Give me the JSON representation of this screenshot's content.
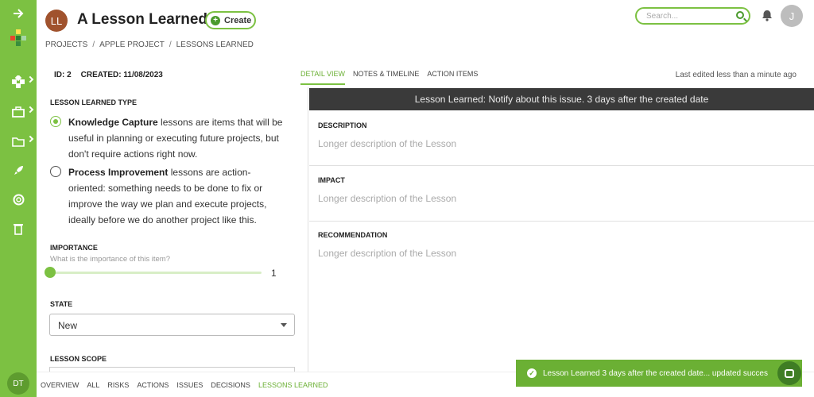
{
  "header": {
    "avatar_initials": "LL",
    "title": "A Lesson Learned",
    "create_label": "Create"
  },
  "breadcrumb": [
    "PROJECTS",
    "APPLE PROJECT",
    "LESSONS LEARNED"
  ],
  "search": {
    "placeholder": "Search..."
  },
  "user": {
    "initial": "J"
  },
  "meta": {
    "id": "ID: 2",
    "created": "CREATED: 11/08/2023"
  },
  "tabs": [
    {
      "label": "DETAIL VIEW",
      "active": true
    },
    {
      "label": "NOTES & TIMELINE",
      "active": false
    },
    {
      "label": "ACTION ITEMS",
      "active": false
    }
  ],
  "last_edited": "Last edited less than a minute ago",
  "lesson_type": {
    "label": "LESSON LEARNED TYPE",
    "options": [
      {
        "title": "Knowledge Capture",
        "text": " lessons are items that will be useful in planning or executing future projects, but don't require actions right now.",
        "checked": true
      },
      {
        "title": "Process Improvement",
        "text": " lessons are action-oriented: something needs to be done to fix or improve the way we plan and execute projects, ideally before we do another project like this.",
        "checked": false
      }
    ]
  },
  "importance": {
    "label": "IMPORTANCE",
    "subtitle": "What is the importance of this item?",
    "value": "1"
  },
  "state": {
    "label": "STATE",
    "value": "New"
  },
  "scope": {
    "label": "LESSON SCOPE"
  },
  "banner": "Lesson Learned: Notify about this issue. 3 days after the created date",
  "details": [
    {
      "label": "DESCRIPTION",
      "value": "Longer description of the Lesson"
    },
    {
      "label": "IMPACT",
      "value": "Longer description of the Lesson"
    },
    {
      "label": "RECOMMENDATION",
      "value": "Longer description of the Lesson"
    }
  ],
  "bottom_nav": [
    {
      "label": "OVERVIEW",
      "active": false
    },
    {
      "label": "ALL",
      "active": false
    },
    {
      "label": "RISKS",
      "active": false
    },
    {
      "label": "ACTIONS",
      "active": false
    },
    {
      "label": "ISSUES",
      "active": false
    },
    {
      "label": "DECISIONS",
      "active": false
    },
    {
      "label": "LESSONS LEARNED",
      "active": true
    }
  ],
  "workspace_initials": "DT",
  "toast": "Lesson Learned 3 days after the created date... updated succes",
  "colors": {
    "accent": "#7cc142",
    "dark_banner": "#3a3a3a",
    "toast": "#6bb034"
  }
}
